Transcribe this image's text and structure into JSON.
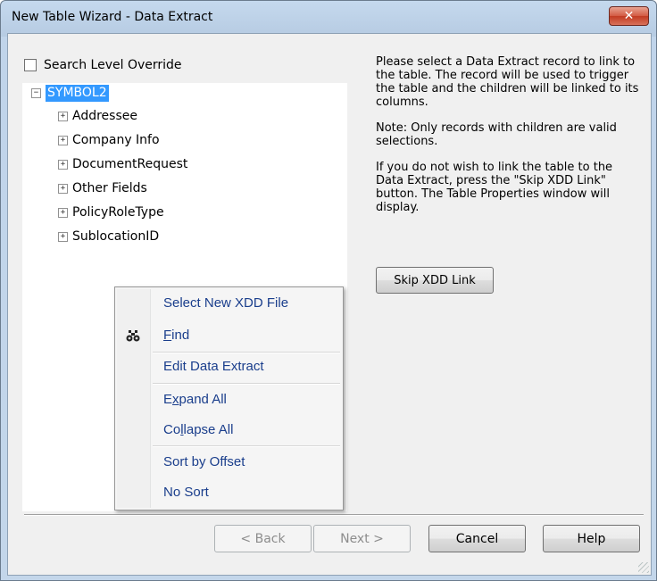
{
  "window": {
    "title": "New Table Wizard - Data Extract",
    "close_glyph": "✕"
  },
  "options": {
    "search_level_override": "Search Level Override",
    "search_level_override_checked": false
  },
  "tree": {
    "expander_glyph": "+",
    "collapse_glyph": "−",
    "root": "SYMBOL2",
    "items": [
      "Addressee",
      "Company Info",
      "DocumentRequest",
      "Other Fields",
      "PolicyRoleType",
      "SublocationID"
    ]
  },
  "instructions": {
    "p1": "Please select a Data Extract record to link to the table.  The record will be used to trigger the table and the children will be linked to its columns.",
    "p2": "Note: Only records with children are valid selections.",
    "p3": "If you do not wish to link the table to the Data Extract, press the \"Skip XDD Link\" button.  The Table Properties window will display."
  },
  "skip_button": "Skip XDD Link",
  "buttons": {
    "back": "< Back",
    "next": "Next >",
    "cancel": "Cancel",
    "help": "Help"
  },
  "context_menu": {
    "items": [
      {
        "label": "Select New XDD File",
        "icon": null
      },
      {
        "label": "Find",
        "accel": "F",
        "rest": "ind",
        "icon": "binoculars-icon"
      },
      {
        "label": "Edit Data Extract",
        "icon": null
      },
      {
        "label": "Expand All",
        "accel": "x",
        "pre": "E",
        "rest": "pand All",
        "icon": null
      },
      {
        "label": "Collapse All",
        "accel": "l",
        "pre": "Co",
        "rest": "lapse All",
        "icon": null
      },
      {
        "label": "Sort by Offset",
        "icon": null
      },
      {
        "label": "No Sort",
        "icon": null
      }
    ]
  }
}
